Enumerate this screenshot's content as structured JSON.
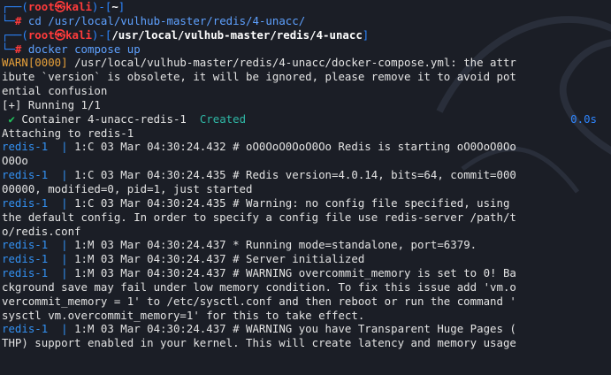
{
  "prompt1": {
    "user": "root",
    "at": "㉿",
    "host": "kali",
    "dir": "~",
    "command": "cd /usr/local/vulhub-master/redis/4-unacc/"
  },
  "prompt2": {
    "user": "root",
    "at": "㉿",
    "host": "kali",
    "dir": "/usr/local/vulhub-master/redis/4-unacc",
    "command": "docker compose up"
  },
  "output": {
    "warn_tag": "WARN[0000]",
    "warn_lines": [
      " /usr/local/vulhub-master/redis/4-unacc/docker-compose.yml: the attr",
      "ibute `version` is obsolete, it will be ignored, please remove it to avoid pot",
      "ential confusion"
    ],
    "running": "[+] Running 1/1",
    "container_check": "✔",
    "container_label": " Container 4-unacc-redis-1",
    "container_status": "Created",
    "container_time": "0.0s",
    "attaching": "Attaching to redis-1",
    "log_prefix": "redis-1",
    "log_sep": "  | ",
    "logs": [
      {
        "prefix": "redis-1",
        "text": "1:C 03 Mar 04:30:24.432 # oO0OoO0OoO0Oo Redis is starting oO0OoO0Oo",
        "cont": [
          "O0Oo"
        ]
      },
      {
        "prefix": "redis-1",
        "text": "1:C 03 Mar 04:30:24.435 # Redis version=4.0.14, bits=64, commit=000",
        "cont": [
          "00000, modified=0, pid=1, just started"
        ]
      },
      {
        "prefix": "redis-1",
        "text": "1:C 03 Mar 04:30:24.435 # Warning: no config file specified, using",
        "cont": [
          "the default config. In order to specify a config file use redis-server /path/t",
          "o/redis.conf"
        ]
      },
      {
        "prefix": "redis-1",
        "text": "1:M 03 Mar 04:30:24.437 * Running mode=standalone, port=6379.",
        "cont": []
      },
      {
        "prefix": "redis-1",
        "text": "1:M 03 Mar 04:30:24.437 # Server initialized",
        "cont": []
      },
      {
        "prefix": "redis-1",
        "text": "1:M 03 Mar 04:30:24.437 # WARNING overcommit_memory is set to 0! Ba",
        "cont": [
          "ckground save may fail under low memory condition. To fix this issue add 'vm.o",
          "vercommit_memory = 1' to /etc/sysctl.conf and then reboot or run the command '",
          "sysctl vm.overcommit_memory=1' for this to take effect."
        ]
      },
      {
        "prefix": "redis-1",
        "text": "1:M 03 Mar 04:30:24.437 # WARNING you have Transparent Huge Pages (",
        "cont": [
          "THP) support enabled in your kernel. This will create latency and memory usage"
        ]
      }
    ]
  },
  "colors": {
    "background": "#1b1e26",
    "prompt_blue": "#2c86ff",
    "prompt_red": "#ff3b3b",
    "warn_orange": "#e8a13a",
    "created_teal": "#2fb8a6",
    "check_green": "#22c55e",
    "redis_blue": "#3391f3"
  }
}
